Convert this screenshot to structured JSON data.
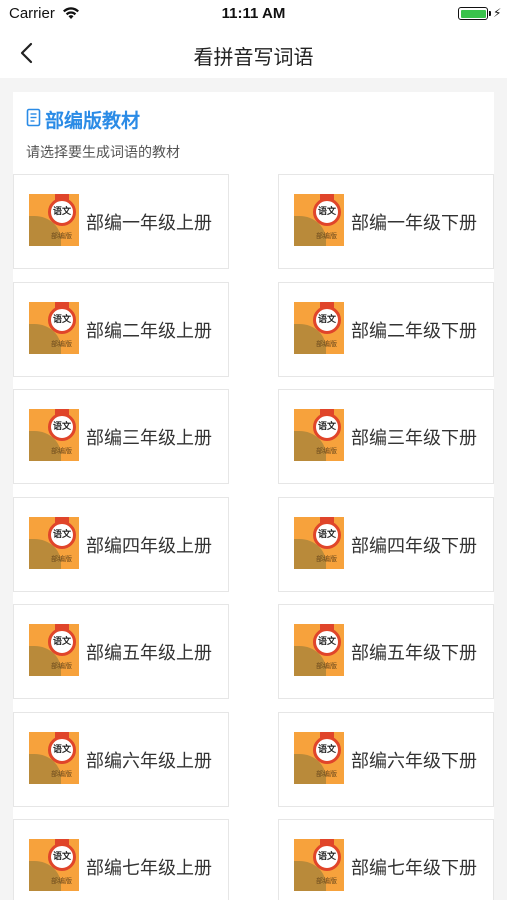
{
  "status_bar": {
    "carrier": "Carrier",
    "time": "11:11 AM",
    "battery_level": 1.0,
    "battery_color": "#39c34b"
  },
  "nav": {
    "title": "看拼音写词语",
    "back_icon": "chevron-left-icon"
  },
  "section": {
    "title": "部编版教材",
    "subtitle": "请选择要生成词语的教材",
    "accent_color": "#2a8be6",
    "icon": "book-icon"
  },
  "cover": {
    "badge_text": "语文",
    "tag_text": "部编版"
  },
  "textbooks": [
    {
      "left": "部编一年级上册",
      "right": "部编一年级下册"
    },
    {
      "left": "部编二年级上册",
      "right": "部编二年级下册"
    },
    {
      "left": "部编三年级上册",
      "right": "部编三年级下册"
    },
    {
      "left": "部编四年级上册",
      "right": "部编四年级下册"
    },
    {
      "left": "部编五年级上册",
      "right": "部编五年级下册"
    },
    {
      "left": "部编六年级上册",
      "right": "部编六年级下册"
    },
    {
      "left": "部编七年级上册",
      "right": "部编七年级下册"
    }
  ]
}
